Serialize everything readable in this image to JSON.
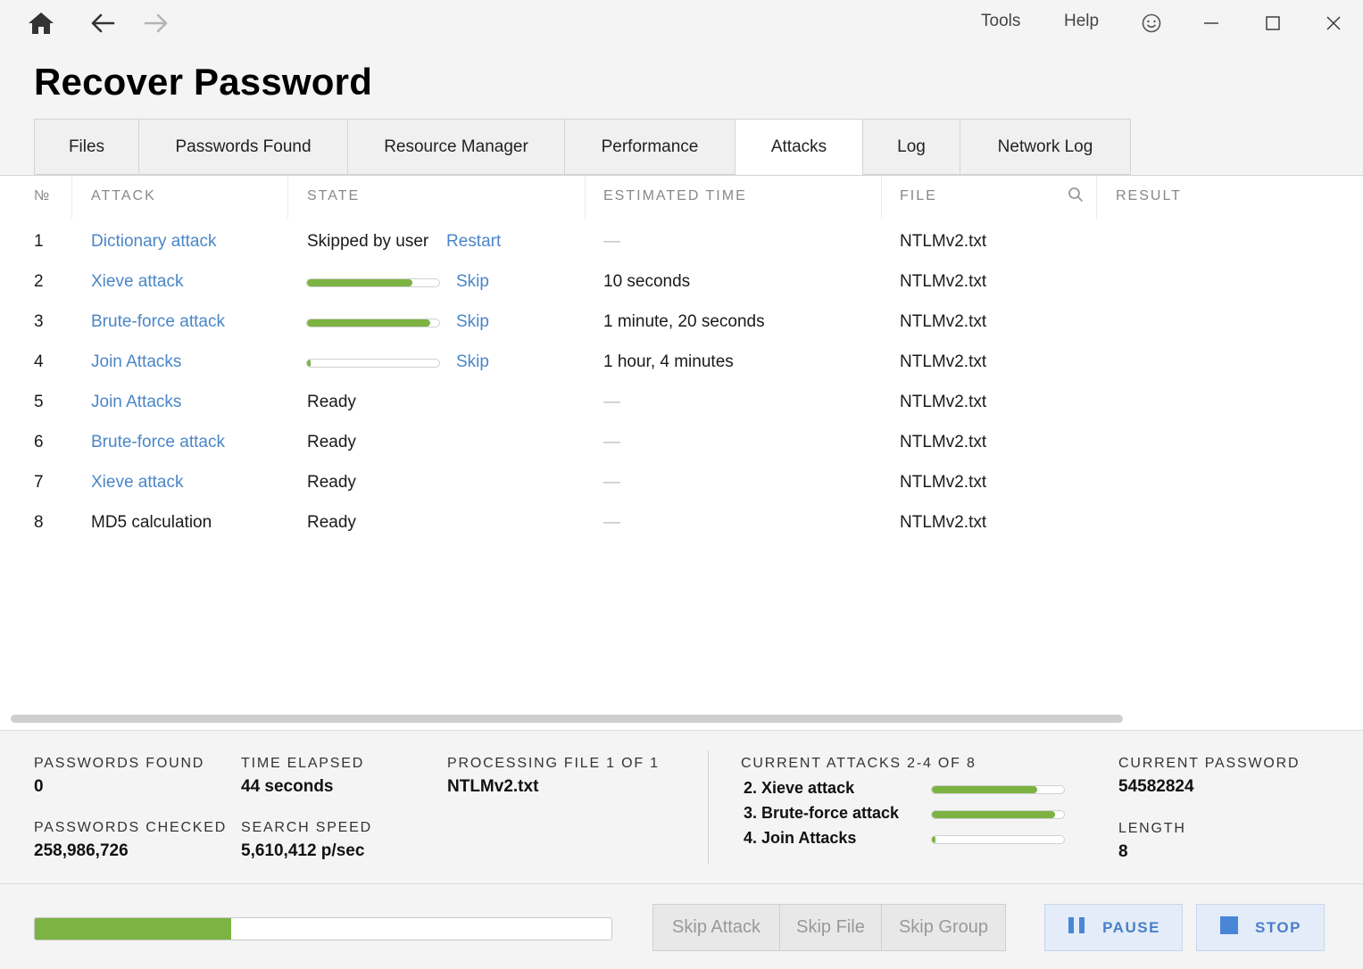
{
  "titlebar": {
    "menu_tools": "Tools",
    "menu_help": "Help"
  },
  "page": {
    "title": "Recover Password"
  },
  "tabs": [
    {
      "label": "Files"
    },
    {
      "label": "Passwords Found"
    },
    {
      "label": "Resource Manager"
    },
    {
      "label": "Performance"
    },
    {
      "label": "Attacks",
      "active": true
    },
    {
      "label": "Log"
    },
    {
      "label": "Network Log"
    }
  ],
  "table": {
    "headers": {
      "num": "№",
      "attack": "ATTACK",
      "state": "STATE",
      "estimated": "ESTIMATED TIME",
      "file": "FILE",
      "result": "RESULT"
    },
    "rows": [
      {
        "num": "1",
        "attack": "Dictionary attack",
        "attack_link": true,
        "state": "Skipped by user",
        "action": "Restart",
        "estimated": "—",
        "file": "NTLMv2.txt"
      },
      {
        "num": "2",
        "attack": "Xieve attack",
        "attack_link": true,
        "progress": 0.8,
        "action": "Skip",
        "estimated": "10 seconds",
        "file": "NTLMv2.txt"
      },
      {
        "num": "3",
        "attack": "Brute-force attack",
        "attack_link": true,
        "progress": 0.93,
        "action": "Skip",
        "estimated": "1 minute, 20 seconds",
        "file": "NTLMv2.txt"
      },
      {
        "num": "4",
        "attack": "Join Attacks",
        "attack_link": true,
        "progress": 0.03,
        "action": "Skip",
        "estimated": "1 hour, 4 minutes",
        "file": "NTLMv2.txt"
      },
      {
        "num": "5",
        "attack": "Join Attacks",
        "attack_link": true,
        "state": "Ready",
        "estimated": "—",
        "file": "NTLMv2.txt"
      },
      {
        "num": "6",
        "attack": "Brute-force attack",
        "attack_link": true,
        "state": "Ready",
        "estimated": "—",
        "file": "NTLMv2.txt"
      },
      {
        "num": "7",
        "attack": "Xieve attack",
        "attack_link": true,
        "state": "Ready",
        "estimated": "—",
        "file": "NTLMv2.txt"
      },
      {
        "num": "8",
        "attack": "MD5 calculation",
        "attack_link": false,
        "state": "Ready",
        "estimated": "—",
        "file": "NTLMv2.txt"
      }
    ]
  },
  "status": {
    "passwords_found_label": "PASSWORDS FOUND",
    "passwords_found": "0",
    "time_elapsed_label": "TIME ELAPSED",
    "time_elapsed": "44 seconds",
    "processing_label": "PROCESSING FILE 1 OF 1",
    "processing_file": "NTLMv2.txt",
    "passwords_checked_label": "PASSWORDS CHECKED",
    "passwords_checked": "258,986,726",
    "search_speed_label": "SEARCH SPEED",
    "search_speed": "5,610,412 p/sec",
    "current_attacks_label": "CURRENT ATTACKS 2-4 OF 8",
    "current_attacks": [
      {
        "name": "2. Xieve attack",
        "progress": 0.8
      },
      {
        "name": "3. Brute-force attack",
        "progress": 0.93
      },
      {
        "name": "4. Join Attacks",
        "progress": 0.03
      }
    ],
    "current_password_label": "CURRENT PASSWORD",
    "current_password": "54582824",
    "length_label": "LENGTH",
    "length": "8"
  },
  "footer": {
    "total_progress": 0.34,
    "skip_attack": "Skip Attack",
    "skip_file": "Skip File",
    "skip_group": "Skip Group",
    "pause": "PAUSE",
    "stop": "STOP"
  },
  "colors": {
    "accent": "#4a86c8",
    "progress": "#7cb342",
    "button_primary_bg": "#e3ecf8"
  }
}
